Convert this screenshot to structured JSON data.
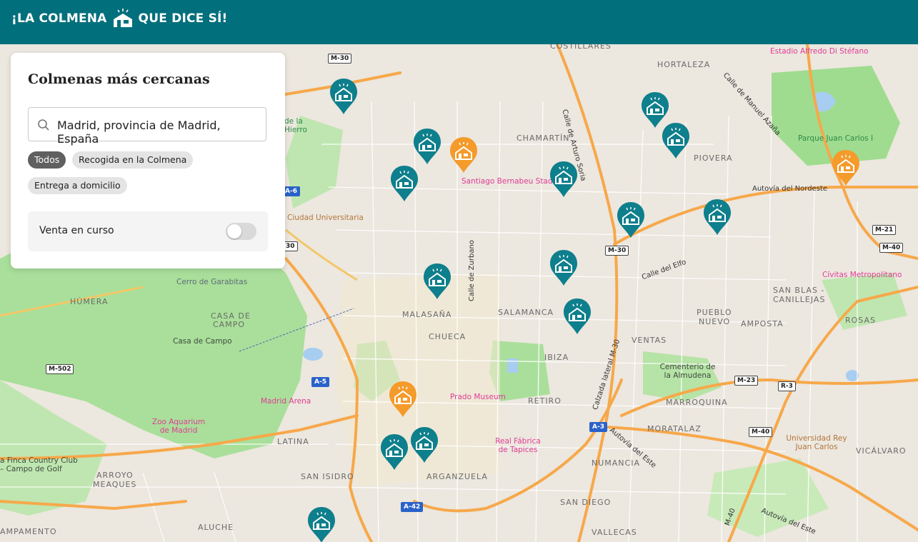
{
  "header": {
    "logo_left": "¡LA COLMENA",
    "logo_right": "QUE DICE SÍ!",
    "color": "#026f7c"
  },
  "panel": {
    "title": "Colmenas más cercanas",
    "search_value": "Madrid, provincia de Madrid, España",
    "filters": [
      "Todos",
      "Recogida en la Colmena",
      "Entrega a domicilio"
    ],
    "active_filter": "Todos",
    "toggle_label": "Venta en curso",
    "toggle_on": false
  },
  "map": {
    "districts": [
      "HORTALEZA",
      "CHAMARTÍN",
      "PIOVERA",
      "SAN BLAS -",
      "CANILLEJAS",
      "PUEBLO",
      "NUEVO",
      "AMPOSTA",
      "ROSAS",
      "VENTAS",
      "SALAMANCA",
      "MALASAÑA",
      "CHUECA",
      "IBIZA",
      "RETIRO",
      "MARROQUINA",
      "MORATALAZ",
      "VICÁLVARO",
      "NUMANCIA",
      "SAN DIEGO",
      "VALLECAS",
      "ARGANZUELA",
      "SAN ISIDRO",
      "LATINA",
      "ALUCHE",
      "ARROYO",
      "MEAQUES",
      "HÚMERA",
      "CASA DE",
      "CAMPO",
      "COSTILLARES",
      "AMPAMENTO"
    ],
    "places": {
      "estadio": "Estadio Alfredo Di Stéfano",
      "juan_carlos": "Parque Juan Carlos I",
      "bernabeu": "Santiago Bernabeu Stadium",
      "ciudad_univ": "Ciudad Universitaria",
      "garabitas": "Cerro de Garabitas",
      "casa_campo": "Casa de Campo",
      "madrid_arena": "Madrid Arena",
      "zoo": "Zoo Aquarium de Madrid",
      "prado": "Prado Museum",
      "tapices": "Real Fábrica de Tapices",
      "almudena": "Cementerio de la Almudena",
      "civitas": "Cívitas Metropolitano",
      "urjc": "Universidad Rey Juan Carlos",
      "finca": "a Finca Country Club – Campo de Golf",
      "hierro": "de la Hierro"
    },
    "streets": {
      "arturo_soria": "Calle de Arturo Soria",
      "manuel_azana": "Calle de Manuel Azaña",
      "zurbano": "Calle de Zurbano",
      "elfo": "Calle del Elfo",
      "nordeste": "Autovía del Nordeste",
      "calzada": "Calzada lateral M-30",
      "este1": "Autovía del Este",
      "este2": "Autovía del Este",
      "m40v": "M-40"
    },
    "shields": [
      "M-30",
      "A-6",
      "30",
      "M-30",
      "M-21",
      "M-40",
      "M-502",
      "A-5",
      "M-23",
      "R-3",
      "A-3",
      "M-40",
      "A-42"
    ],
    "pin_colors": {
      "teal": "#0e7f8c",
      "orange": "#f49b2b"
    }
  }
}
